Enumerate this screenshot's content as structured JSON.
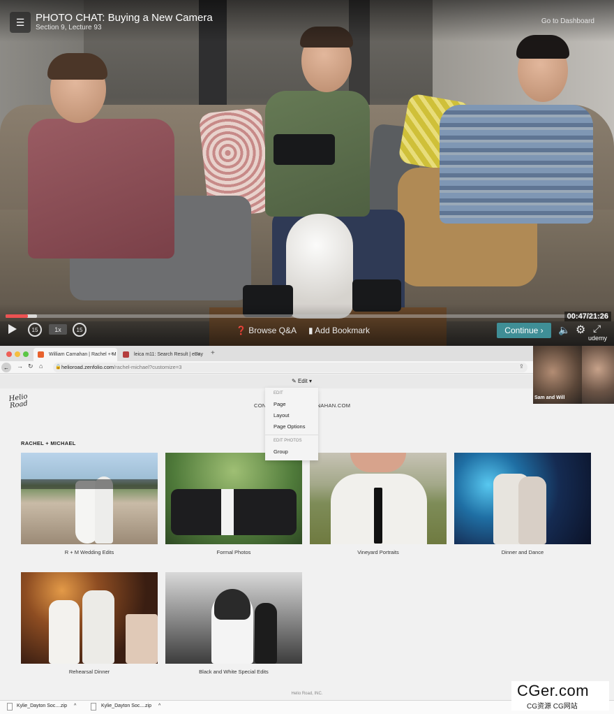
{
  "player": {
    "title": "PHOTO CHAT: Buying a New Camera",
    "subtitle": "Section 9, Lecture 93",
    "dashboard_link": "Go to Dashboard",
    "time": "00:47/21:26",
    "progress_fraction": 0.037,
    "speed": "1x",
    "rewind": "15",
    "forward": "15",
    "browse_qa": "Browse Q&A",
    "add_bookmark": "Add Bookmark",
    "continue": "Continue",
    "brand": "udemy",
    "accent_color": "#ec5252",
    "continue_color": "#3f8e96"
  },
  "browser": {
    "tabs": [
      {
        "label": "William Carnahan | Rachel + M"
      },
      {
        "label": "leica m11: Search Result | eBay"
      }
    ],
    "url_host": "helioroad.zenfolio.com",
    "url_path": "/rachel-michael?customize=3",
    "edit_label": "Edit",
    "dropdown": {
      "edit_heading": "EDIT",
      "items": [
        "Page",
        "Layout",
        "Page Options"
      ],
      "photos_heading": "EDIT PHOTOS",
      "photo_items": [
        "Group"
      ]
    }
  },
  "site": {
    "logo": "Helio Road",
    "nav": "CONTACT     WILLIAMCARNAHAN.COM",
    "gallery_title": "RACHEL + MICHAEL",
    "galleries": [
      {
        "caption": "R + M Wedding Edits"
      },
      {
        "caption": "Formal Photos"
      },
      {
        "caption": "Vineyard Portraits"
      },
      {
        "caption": "Dinner and Dance"
      },
      {
        "caption": "Rehearsal Dinner"
      },
      {
        "caption": "Black and White Special Edits"
      }
    ],
    "footer": "Helio Road, INC."
  },
  "webcam": {
    "label": "Sam and Will"
  },
  "downloads": [
    {
      "name": "Kylie_Dayton Soc....zip"
    },
    {
      "name": "Kylie_Dayton Soc....zip"
    }
  ],
  "watermark": {
    "main": "CGer.com",
    "sub": "CG资源 CG网站"
  }
}
